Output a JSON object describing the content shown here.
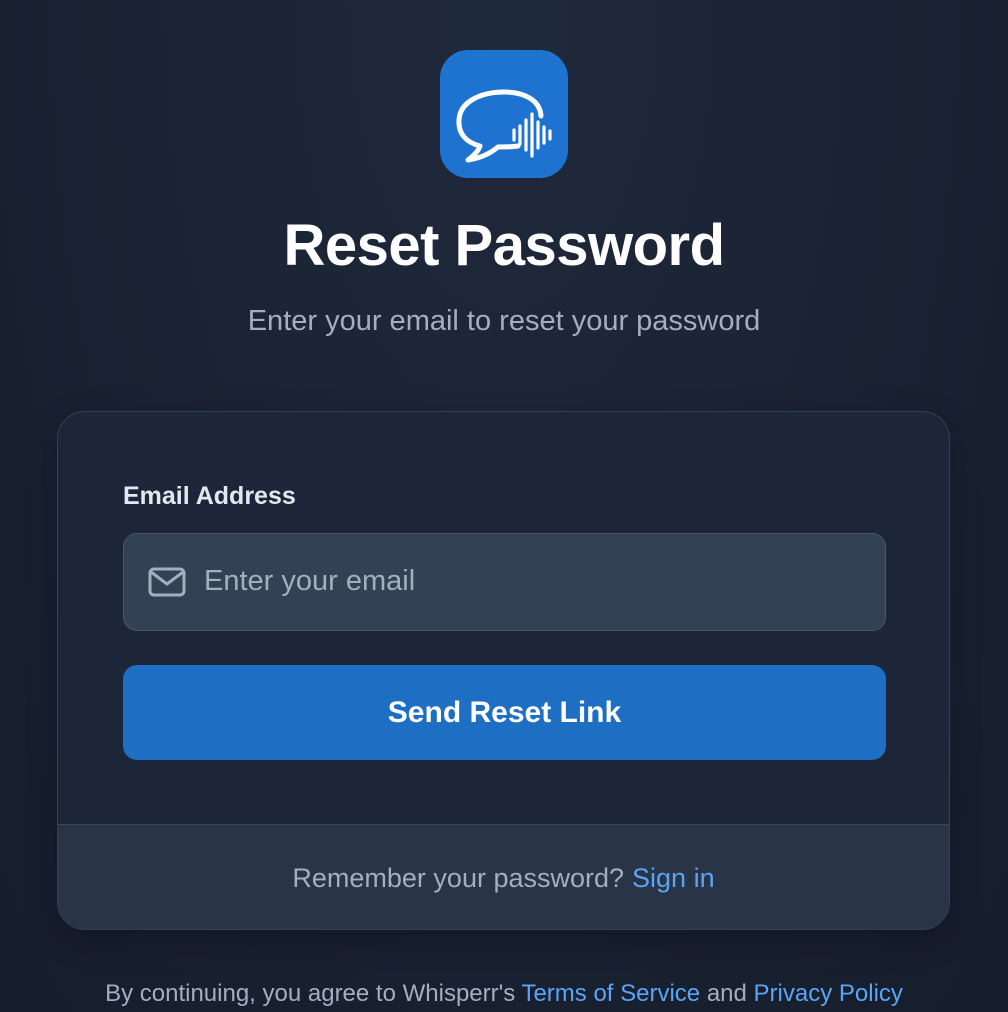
{
  "header": {
    "logo_icon": "chat-bubble-soundwave-icon",
    "title": "Reset Password",
    "subtitle": "Enter your email to reset your password"
  },
  "form": {
    "email_label": "Email Address",
    "email_placeholder": "Enter your email",
    "email_value": "",
    "email_icon": "mail-icon",
    "submit_label": "Send Reset Link"
  },
  "footer": {
    "prompt": "Remember your password?",
    "signin_label": "Sign in"
  },
  "legal": {
    "prefix": "By continuing, you agree to Whisperr's ",
    "terms_label": "Terms of Service",
    "conjunction": " and ",
    "privacy_label": "Privacy Policy"
  },
  "colors": {
    "background": "#1b2334",
    "card": "#1d2638",
    "card_footer": "#293446",
    "input": "#334155",
    "primary": "#1e6fc4",
    "link": "#5aa4f5",
    "muted_text": "#a3aebf"
  }
}
